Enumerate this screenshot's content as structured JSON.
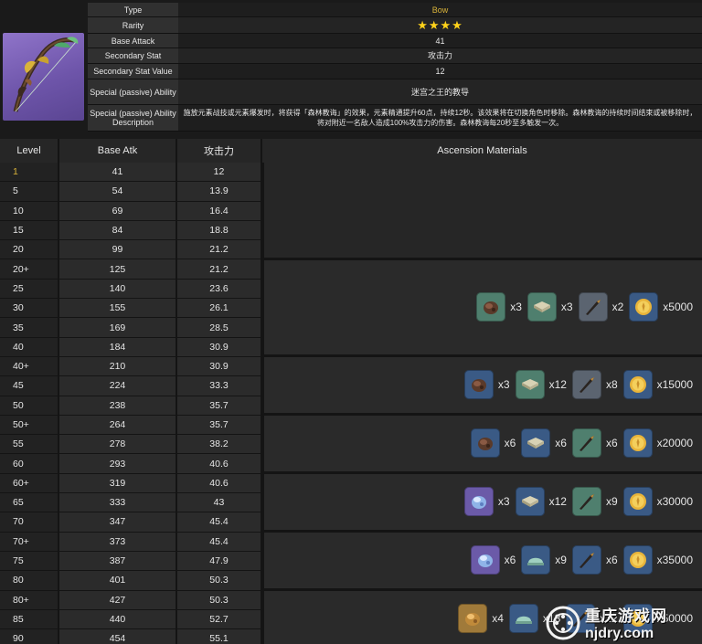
{
  "info": {
    "type_label": "Type",
    "type_value": "Bow",
    "rarity_label": "Rarity",
    "rarity_stars": "★★★★",
    "base_attack_label": "Base Attack",
    "base_attack_value": "41",
    "secondary_stat_label": "Secondary Stat",
    "secondary_stat_value": "攻击力",
    "secondary_stat_value_label": "Secondary Stat Value",
    "secondary_stat_value_value": "12",
    "passive_label": "Special (passive) Ability",
    "passive_value": "迷宫之王的教导",
    "passive_desc_label": "Special (passive) Ability Description",
    "passive_desc_value": "施放元素战技或元素爆发时，将获得「森林教诲」的效果，元素精通提升60点，持续12秒。该效果将在切换角色时移除。森林教诲的持续时间结束或被移除时，将对附近一名敌人造成100%攻击力的伤害。森林教诲每20秒至多触发一次。"
  },
  "table": {
    "headers": {
      "level": "Level",
      "base_atk": "Base Atk",
      "secondary": "攻击力",
      "materials": "Ascension Materials"
    },
    "rows": [
      {
        "level": "1",
        "atk": "41",
        "sec": "12"
      },
      {
        "level": "5",
        "atk": "54",
        "sec": "13.9"
      },
      {
        "level": "10",
        "atk": "69",
        "sec": "16.4"
      },
      {
        "level": "15",
        "atk": "84",
        "sec": "18.8"
      },
      {
        "level": "20",
        "atk": "99",
        "sec": "21.2"
      },
      {
        "level": "20+",
        "atk": "125",
        "sec": "21.2"
      },
      {
        "level": "25",
        "atk": "140",
        "sec": "23.6"
      },
      {
        "level": "30",
        "atk": "155",
        "sec": "26.1"
      },
      {
        "level": "35",
        "atk": "169",
        "sec": "28.5"
      },
      {
        "level": "40",
        "atk": "184",
        "sec": "30.9"
      },
      {
        "level": "40+",
        "atk": "210",
        "sec": "30.9"
      },
      {
        "level": "45",
        "atk": "224",
        "sec": "33.3"
      },
      {
        "level": "50",
        "atk": "238",
        "sec": "35.7"
      },
      {
        "level": "50+",
        "atk": "264",
        "sec": "35.7"
      },
      {
        "level": "55",
        "atk": "278",
        "sec": "38.2"
      },
      {
        "level": "60",
        "atk": "293",
        "sec": "40.6"
      },
      {
        "level": "60+",
        "atk": "319",
        "sec": "40.6"
      },
      {
        "level": "65",
        "atk": "333",
        "sec": "43"
      },
      {
        "level": "70",
        "atk": "347",
        "sec": "45.4"
      },
      {
        "level": "70+",
        "atk": "373",
        "sec": "45.4"
      },
      {
        "level": "75",
        "atk": "387",
        "sec": "47.9"
      },
      {
        "level": "80",
        "atk": "401",
        "sec": "50.3"
      },
      {
        "level": "80+",
        "atk": "427",
        "sec": "50.3"
      },
      {
        "level": "85",
        "atk": "440",
        "sec": "52.7"
      },
      {
        "level": "90",
        "atk": "454",
        "sec": "55.1"
      }
    ]
  },
  "materials": [
    {
      "rows": 5,
      "items": []
    },
    {
      "rows": 5,
      "items": [
        {
          "icon": "weapon-ore-icon",
          "bg": "#4f7f6e",
          "qty": "x3"
        },
        {
          "icon": "scroll-icon",
          "bg": "#4f7f6e",
          "qty": "x3"
        },
        {
          "icon": "arrowhead-icon",
          "bg": "#5b6470",
          "qty": "x2"
        },
        {
          "icon": "mora-icon",
          "bg": "#3a5a85",
          "qty": "x5000"
        }
      ]
    },
    {
      "rows": 3,
      "items": [
        {
          "icon": "weapon-ore-icon",
          "bg": "#3a5a85",
          "qty": "x3"
        },
        {
          "icon": "scroll-icon",
          "bg": "#4f7f6e",
          "qty": "x12"
        },
        {
          "icon": "arrowhead-icon",
          "bg": "#5b6470",
          "qty": "x8"
        },
        {
          "icon": "mora-icon",
          "bg": "#3a5a85",
          "qty": "x15000"
        }
      ]
    },
    {
      "rows": 3,
      "items": [
        {
          "icon": "weapon-ore-icon",
          "bg": "#3a5a85",
          "qty": "x6"
        },
        {
          "icon": "scroll-icon",
          "bg": "#3a5a85",
          "qty": "x6"
        },
        {
          "icon": "arrowhead-icon",
          "bg": "#4f7f6e",
          "qty": "x6"
        },
        {
          "icon": "mora-icon",
          "bg": "#3a5a85",
          "qty": "x20000"
        }
      ]
    },
    {
      "rows": 3,
      "items": [
        {
          "icon": "crystal-ore-icon",
          "bg": "#6b5aa8",
          "qty": "x3"
        },
        {
          "icon": "scroll-icon",
          "bg": "#3a5a85",
          "qty": "x12"
        },
        {
          "icon": "arrowhead-icon",
          "bg": "#4f7f6e",
          "qty": "x9"
        },
        {
          "icon": "mora-icon",
          "bg": "#3a5a85",
          "qty": "x30000"
        }
      ]
    },
    {
      "rows": 3,
      "items": [
        {
          "icon": "crystal-ore-icon",
          "bg": "#6b5aa8",
          "qty": "x6"
        },
        {
          "icon": "helmet-icon",
          "bg": "#3a5a85",
          "qty": "x9"
        },
        {
          "icon": "arrowhead-icon",
          "bg": "#3a5a85",
          "qty": "x6"
        },
        {
          "icon": "mora-icon",
          "bg": "#3a5a85",
          "qty": "x35000"
        }
      ]
    },
    {
      "rows": 3,
      "items": [
        {
          "icon": "amber-ore-icon",
          "bg": "#a07a3a",
          "qty": "x4"
        },
        {
          "icon": "helmet-icon",
          "bg": "#3a5a85",
          "qty": "x18"
        },
        {
          "icon": "arrowhead-icon",
          "bg": "#3a5a85",
          "qty": "x12"
        },
        {
          "icon": "mora-icon",
          "bg": "#3a5a85",
          "qty": "x50000"
        }
      ]
    }
  ],
  "watermark": {
    "cn": "重庆游戏网",
    "en": "njdry.com"
  }
}
